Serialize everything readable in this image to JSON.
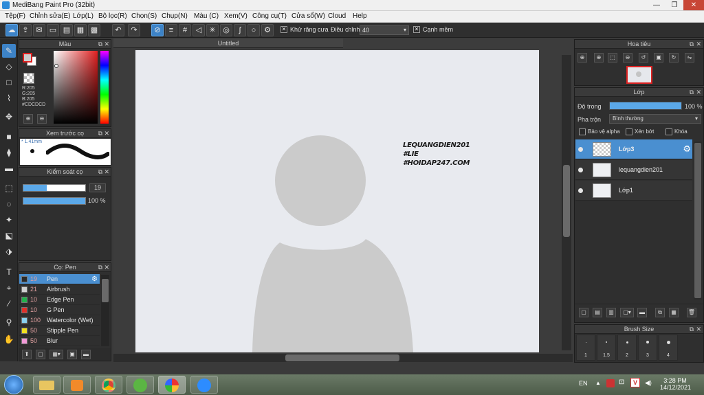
{
  "window": {
    "title": "MediBang Paint Pro (32bit)",
    "min": "—",
    "max": "❐",
    "close": "✕"
  },
  "menu": [
    "Tệp(F)",
    "Chỉnh sửa(E)",
    "Lớp(L)",
    "Bộ lọc(R)",
    "Chọn(S)",
    "Chụp(N)",
    "Màu (C)",
    "Xem(V)",
    "Công cụ(T)",
    "Cửa sổ(W)",
    "Cloud",
    "Help"
  ],
  "toolbar": {
    "antialias_label": "Khử răng cưa",
    "correction_label": "Điều chỉnh",
    "correction_value": "40",
    "snap_label": "Cạnh mềm"
  },
  "color_panel": {
    "title": "Màu",
    "r": "R:205",
    "g": "G:205",
    "b": "B:205",
    "hex": "#CDCDCD",
    "primary": "#cdcdcd",
    "secondary": "#ffffff",
    "accent": "#e02020"
  },
  "brush_preview": {
    "title": "Xem trước cọ",
    "size": "* 1.41mm"
  },
  "brush_control": {
    "title": "Kiểm soát cọ",
    "size_value": "19",
    "opacity_value": "100 %"
  },
  "brush_panel": {
    "title": "Cọ: Pen",
    "items": [
      {
        "size": "19",
        "name": "Pen",
        "color": "#2a2a2a"
      },
      {
        "size": "21",
        "name": "Airbrush",
        "color": "#d0d0d0"
      },
      {
        "size": "10",
        "name": "Edge Pen",
        "color": "#22b14c"
      },
      {
        "size": "10",
        "name": "G Pen",
        "color": "#e0302a"
      },
      {
        "size": "100",
        "name": "Watercolor (Wet)",
        "color": "#8ad2f0"
      },
      {
        "size": "50",
        "name": "Stipple Pen",
        "color": "#f0e020"
      },
      {
        "size": "50",
        "name": "Blur",
        "color": "#f29ad8"
      }
    ]
  },
  "canvas": {
    "tab": "Untitled",
    "text_lines": [
      "LEQUANGDIEN201",
      "#LIE",
      "#HOIDAP247.COM"
    ]
  },
  "navigator": {
    "title": "Hoa tiêu"
  },
  "layer_panel": {
    "title": "Lớp",
    "opacity_label": "Độ trong",
    "opacity_value": "100 %",
    "blend_label": "Pha trộn",
    "blend_value": "Bình thường",
    "protect_alpha": "Bảo vệ alpha",
    "clipping": "Xén bớt",
    "lock": "Khóa",
    "layers": [
      {
        "name": "Lớp3",
        "selected": true
      },
      {
        "name": "lequangdien201",
        "selected": false
      },
      {
        "name": "Lớp1",
        "selected": false
      }
    ]
  },
  "brush_size": {
    "title": "Brush Size",
    "values": [
      "1",
      "1.5",
      "2",
      "3",
      "4"
    ]
  },
  "taskbar": {
    "lang": "EN",
    "time": "3:28 PM",
    "date": "14/12/2021"
  }
}
